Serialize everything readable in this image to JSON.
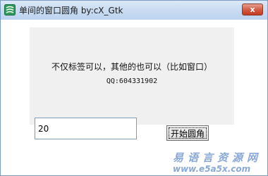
{
  "window": {
    "title": "单间的窗口圆角  by:cX_Gtk",
    "close_label": "x"
  },
  "panel": {
    "line1": "不仅标签可以，其他的也可以（比如窗口）",
    "line2": "QQ:604331902"
  },
  "input": {
    "value": "20"
  },
  "button": {
    "label": "开始圆角"
  },
  "watermark": {
    "top": "易语言资源网",
    "bottom": "www.e5a5x.com"
  },
  "colors": {
    "titlebar": "#c9dcf2",
    "panel": "#f0f0f0",
    "close": "#c23b22",
    "watermark": "#2b62b8"
  },
  "icons": [
    "app-icon",
    "close-icon"
  ]
}
